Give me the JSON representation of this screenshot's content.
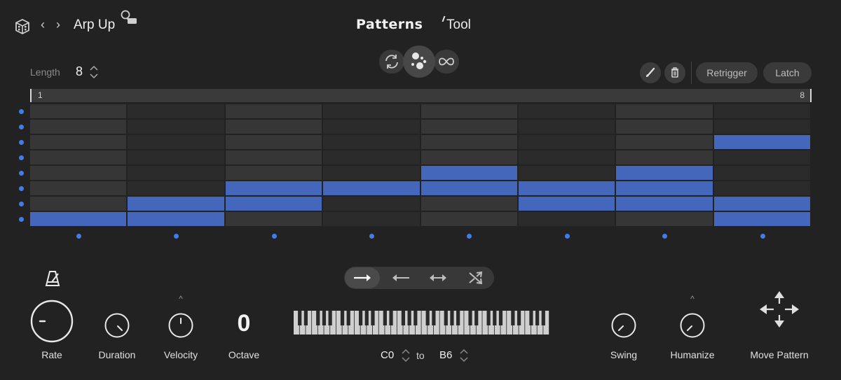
{
  "header": {
    "preset_name": "Arp Up",
    "logo_brand": "Patterns",
    "logo_tool": "Tool",
    "icons": [
      "cube-icon",
      "chevron-left-icon",
      "chevron-right-icon",
      "lock-icon"
    ]
  },
  "modes": {
    "items": [
      "loop-icon",
      "random-dots-icon",
      "infinity-icon"
    ],
    "selected": "random-dots-icon"
  },
  "length": {
    "label": "Length",
    "value": "8"
  },
  "toolbar": {
    "retrigger_label": "Retrigger",
    "latch_label": "Latch",
    "icons": [
      "brush-icon",
      "trash-icon"
    ]
  },
  "ruler": {
    "start_label": "1",
    "end_label": "8"
  },
  "pattern": {
    "steps": 8,
    "rows": 8,
    "active_rows_per_step": [
      [
        7
      ],
      [
        6,
        7
      ],
      [
        5,
        6
      ],
      [
        5
      ],
      [
        4,
        5
      ],
      [
        5,
        6
      ],
      [
        4,
        5,
        6
      ],
      [
        2,
        6,
        7
      ]
    ],
    "accent_color": "#4466bb"
  },
  "direction": {
    "items": [
      "arrow-right-icon",
      "arrow-left-icon",
      "arrow-both-icon",
      "shuffle-icon"
    ],
    "selected": "arrow-right-icon"
  },
  "controls": {
    "rate_label": "Rate",
    "duration_label": "Duration",
    "velocity_label": "Velocity",
    "octave_label": "Octave",
    "octave_value": "0",
    "swing_label": "Swing",
    "humanize_label": "Humanize",
    "move_pattern_label": "Move Pattern"
  },
  "range": {
    "low": "C0",
    "to_label": "to",
    "high": "B6"
  }
}
